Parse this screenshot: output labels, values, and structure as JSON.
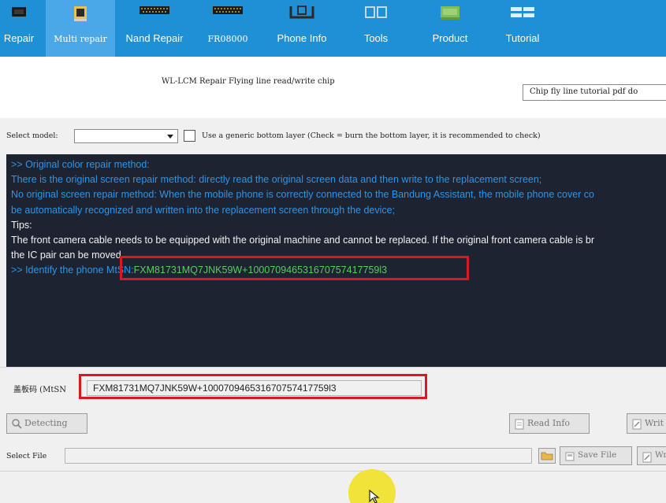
{
  "nav": {
    "items": [
      {
        "label": "Repair",
        "icon": "chip-icon",
        "active": false
      },
      {
        "label": "Multi repair",
        "icon": "screen-icon",
        "active": true
      },
      {
        "label": "Nand Repair",
        "icon": "nand-icon",
        "active": false
      },
      {
        "label": "FR08000",
        "icon": "programmer-icon",
        "active": false
      },
      {
        "label": "Phone Info",
        "icon": "phone-info-icon",
        "active": false
      },
      {
        "label": "Tools",
        "icon": "tools-icon",
        "active": false
      },
      {
        "label": "Product",
        "icon": "product-icon",
        "active": false
      },
      {
        "label": "Tutorial",
        "icon": "tutorial-icon",
        "active": false
      }
    ]
  },
  "header": {
    "title": "WL-LCM Repair Flying line read/write chip",
    "tutorial_button": "Chip fly line tutorial pdf do"
  },
  "model_row": {
    "label": "Select model:",
    "selected": "",
    "generic_checkbox_checked": false,
    "generic_label": "Use a generic bottom layer (Check = burn the bottom layer, it is recommended to check)"
  },
  "console": {
    "line1": ">> Original color repair method:",
    "line2": "There is the original screen repair method: directly read the original screen data and then write to the replacement screen;",
    "line3": "No original screen repair method: When the mobile phone is correctly connected to the Bandung Assistant, the mobile phone cover co",
    "line4": "be automatically recognized and written into the replacement screen through the device;",
    "line5": "Tips:",
    "line6": "The front camera cable needs to be equipped with the original machine and cannot be replaced. If the original front camera cable is br",
    "line7": "the IC pair can be moved.",
    "line8_prefix": " >> Identify the phone MtSN:",
    "line8_value": "FXM81731MQ7JNK59W+100070946531670757417759l3"
  },
  "mtsn": {
    "label": "盖板码 (MtSN",
    "value": "FXM81731MQ7JNK59W+100070946531670757417759l3"
  },
  "buttons": {
    "detecting": "Detecting",
    "read_info": "Read Info",
    "write": "Writ",
    "save_file": "Save File",
    "write_file": "Wr"
  },
  "file_row": {
    "label": "Select File",
    "value": ""
  },
  "colors": {
    "nav_bg": "#1f8fd6",
    "nav_active": "#4aa8e8",
    "console_bg": "#1d2330",
    "console_blue": "#2e95e8",
    "console_green": "#56d05c",
    "highlight_red": "#d8191f",
    "cursor_halo": "#f2e33a"
  }
}
